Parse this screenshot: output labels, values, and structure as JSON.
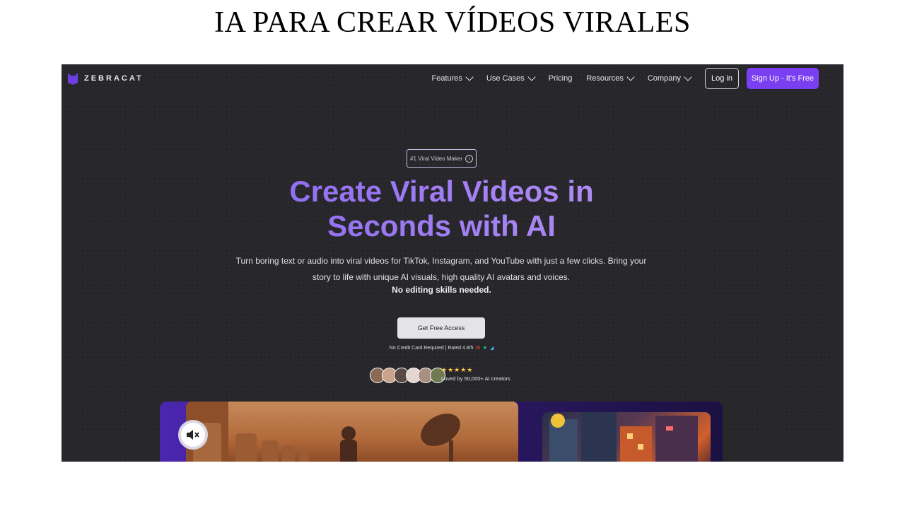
{
  "slide": {
    "title": "IA PARA CREAR VÍDEOS VIRALES"
  },
  "colors": {
    "accent": "#7b3ff2",
    "background": "#27262b",
    "star": "#ffc83d"
  },
  "header": {
    "brand": "ZEBRACAT",
    "logo_icon": "cat-logo-icon",
    "nav": [
      {
        "label": "Features",
        "has_dropdown": true
      },
      {
        "label": "Use Cases",
        "has_dropdown": true
      },
      {
        "label": "Pricing",
        "has_dropdown": false
      },
      {
        "label": "Resources",
        "has_dropdown": true
      },
      {
        "label": "Company",
        "has_dropdown": true
      }
    ],
    "login_label": "Log in",
    "signup_label": "Sign Up - It's Free"
  },
  "hero": {
    "badge": "#1 Viral Video Maker",
    "title_line1": "Create Viral Videos in",
    "title_line2": "Seconds with AI",
    "subtitle": "Turn boring text or audio into viral videos for TikTok, Instagram, and YouTube with just a few clicks. Bring your story to life with unique AI visuals, high quality AI avatars and voices.",
    "strong": "No editing skills needed.",
    "cta_label": "Get Free Access",
    "cta_note": "No Credit Card Required | Rated 4.8/5",
    "stars": "★★★★★",
    "rating_stars": 5,
    "loved": "Loved by 50,000+ AI creators"
  },
  "media": {
    "mute_icon": "speaker-muted-icon"
  }
}
